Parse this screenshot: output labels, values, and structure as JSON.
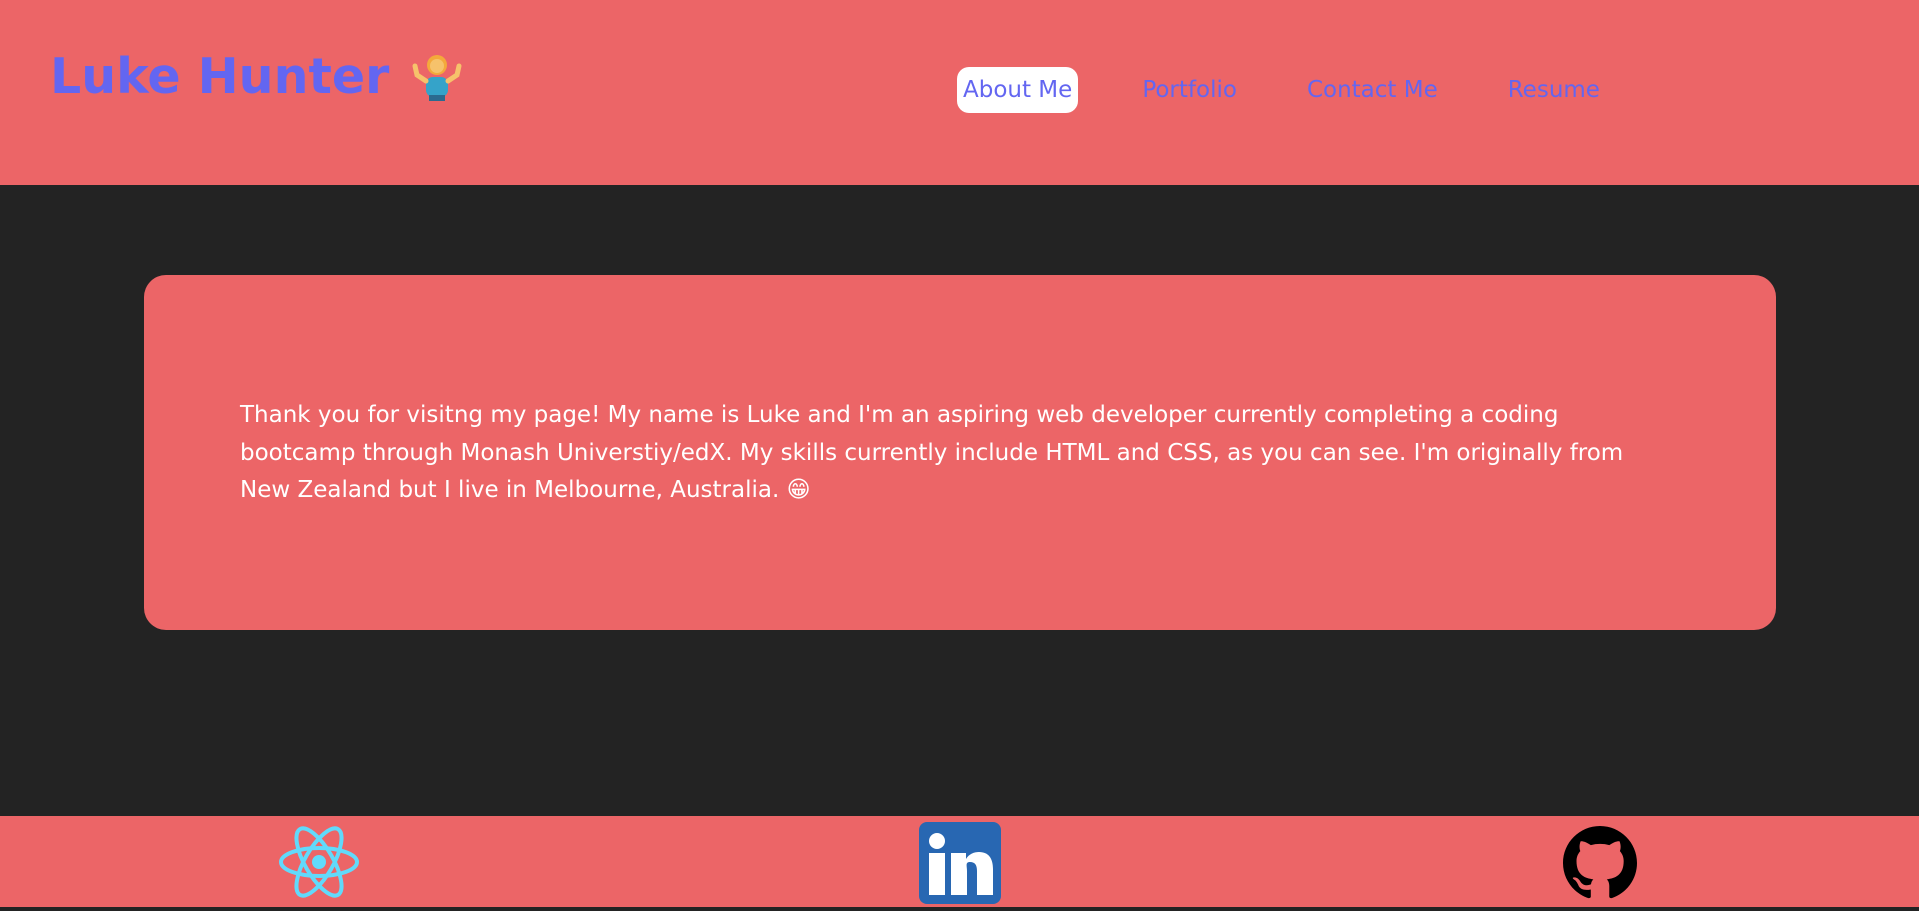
{
  "header": {
    "brand_title": "Luke Hunter",
    "brand_emoji": "person-shrugging-icon",
    "nav": [
      {
        "label": "About Me",
        "active": true
      },
      {
        "label": "Portfolio",
        "active": false
      },
      {
        "label": "Contact Me",
        "active": false
      },
      {
        "label": "Resume",
        "active": false
      }
    ]
  },
  "main": {
    "about_text": "Thank you for visitng my page! My name is Luke and I'm an aspiring web developer currently completing a coding bootcamp through Monash Universtiy/edX. My skills currently include HTML and CSS, as you can see. I'm originally from New Zealand but I live in Melbourne, Australia. 😁"
  },
  "footer": {
    "icons": [
      "react-icon",
      "linkedin-icon",
      "github-icon"
    ]
  },
  "colors": {
    "accent": "#ec6567",
    "background": "#232323",
    "brand": "#6366f1",
    "text": "#ffffff"
  }
}
